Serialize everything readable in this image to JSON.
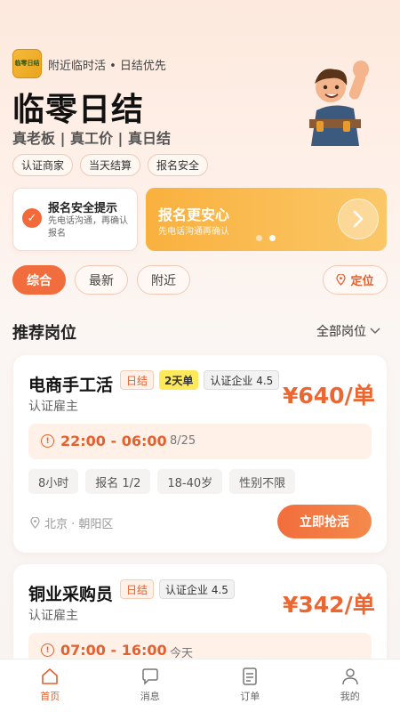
{
  "header": {
    "logo_text": "临零日结",
    "tagline": "附近临时活 • 日结优先",
    "title": "临零日结",
    "subtitle": "真老板 | 真工价 | 真日结",
    "tags": [
      "认证商家",
      "当天结算",
      "报名安全"
    ]
  },
  "notice": {
    "title": "报名安全提示",
    "desc": "先电话沟通，再确认报名"
  },
  "promo": {
    "title": "报名更安心",
    "desc": "先电话沟通再确认",
    "dots": 2,
    "active_dot": 1
  },
  "filters": {
    "items": [
      "综合",
      "最新",
      "附近"
    ],
    "active": 0,
    "locate_label": "定位"
  },
  "section": {
    "title": "推荐岗位",
    "all_label": "全部岗位"
  },
  "jobs": [
    {
      "title": "电商手工活",
      "badges": [
        "日结",
        "2天单",
        "认证企业 4.5"
      ],
      "employer": "认证雇主",
      "price": "¥640/单",
      "time": "22:00 - 06:00",
      "date": "8/25",
      "meta": [
        "8小时",
        "报名 1/2",
        "18-40岁",
        "性别不限"
      ],
      "location": "北京 · 朝阳区",
      "button": "立即抢活"
    },
    {
      "title": "铜业采购员",
      "badges": [
        "日结",
        "认证企业 4.5"
      ],
      "employer": "认证雇主",
      "price": "¥342/单",
      "time": "07:00 - 16:00",
      "date": "今天"
    }
  ],
  "nav": [
    {
      "label": "首页",
      "icon": "home-icon"
    },
    {
      "label": "消息",
      "icon": "message-icon"
    },
    {
      "label": "订单",
      "icon": "order-icon"
    },
    {
      "label": "我的",
      "icon": "user-icon"
    }
  ],
  "colors": {
    "accent": "#f26d3d",
    "promo": "#f9b13e",
    "badge_yellow": "#fde95a"
  }
}
